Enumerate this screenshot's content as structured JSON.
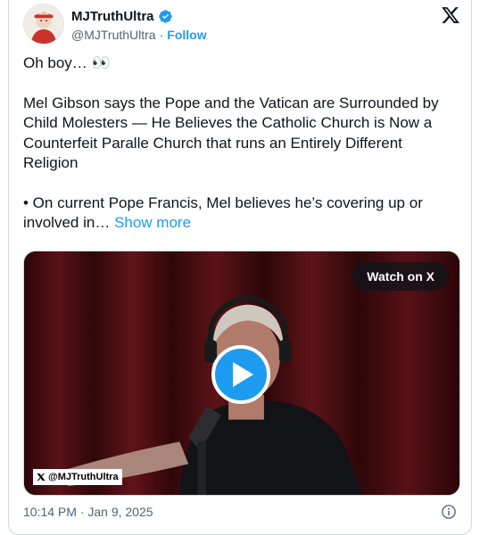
{
  "author": {
    "display_name": "MJTruthUltra",
    "handle": "@MJTruthUltra",
    "separator": "·",
    "follow_label": "Follow"
  },
  "icons": {
    "verified": "verified-badge-icon",
    "brand": "x-logo-icon",
    "info": "info-icon",
    "play": "play-icon"
  },
  "tweet": {
    "line1": "Oh boy… 👀",
    "paragraph2": "Mel Gibson says the Pope and the Vatican are Surrounded by Child Molesters — He Believes the Catholic Church is Now a Counterfeit Paralle Church that runs an Entirely Different Religion",
    "paragraph3": "• On current Pope Francis, Mel believes he’s covering up or involved in…",
    "show_more": "Show more"
  },
  "media": {
    "watch_label": "Watch on X",
    "watermark": "@MJTruthUltra"
  },
  "timestamp": "10:14 PM · Jan 9, 2025",
  "colors": {
    "accent": "#1d9bf0",
    "text": "#0f1419",
    "muted": "#536471",
    "border": "#cfd9de"
  }
}
